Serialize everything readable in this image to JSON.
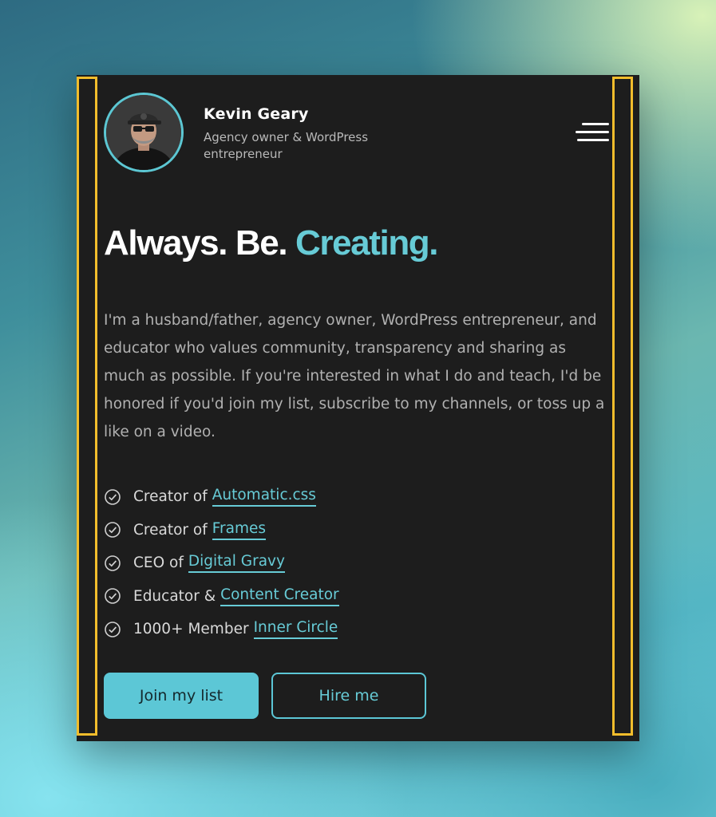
{
  "profile": {
    "name": "Kevin Geary",
    "tagline": "Agency owner & WordPress entrepreneur"
  },
  "menu": {
    "icon": "hamburger-menu-icon"
  },
  "hero": {
    "headline_plain": "Always. Be.",
    "headline_accent": "Creating."
  },
  "bio": "I'm a husband/father, agency owner, WordPress entrepreneur, and educator who values community, transparency and sharing as much as possible. If you're interested in what I do and teach, I'd be honored if you'd join my list, subscribe to my channels, or toss up a like on a video.",
  "credits": [
    {
      "prefix": "Creator of",
      "link": "Automatic.css"
    },
    {
      "prefix": "Creator of",
      "link": "Frames"
    },
    {
      "prefix": "CEO of",
      "link": "Digital Gravy"
    },
    {
      "prefix": "Educator &",
      "link": "Content Creator"
    },
    {
      "prefix": "1000+ Member",
      "link": "Inner Circle"
    }
  ],
  "buttons": {
    "join_label": "Join my list",
    "hire_label": "Hire me"
  },
  "colors": {
    "accent": "#67cbd6",
    "panel_bg": "#1d1d1d",
    "guide_outline": "#f2bd2c"
  }
}
